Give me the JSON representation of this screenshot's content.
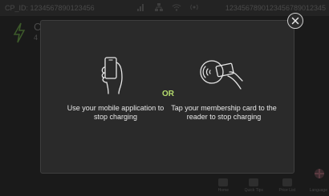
{
  "background": {
    "cp_id": "CP_ID: 1234567890123456",
    "serial": "1234567890123456789012345",
    "title": "C",
    "subtitle": "4",
    "nav": [
      {
        "label": "Home",
        "icon": "home-icon"
      },
      {
        "label": "Quick Tips",
        "icon": "tips-icon"
      },
      {
        "label": "Price List",
        "icon": "price-list-icon"
      },
      {
        "label": "Language",
        "icon": "flag-icon"
      }
    ]
  },
  "modal": {
    "options": [
      {
        "text": "Use your mobile application to stop charging",
        "icon": "mobile-phone-hand-icon"
      },
      {
        "text": "Tap your membership card to the reader to stop charging",
        "icon": "rfid-card-tap-icon"
      }
    ],
    "or_label": "OR",
    "close_icon": "close-icon"
  },
  "colors": {
    "accent": "#b6dd6e",
    "panel": "#2a2a2a"
  }
}
